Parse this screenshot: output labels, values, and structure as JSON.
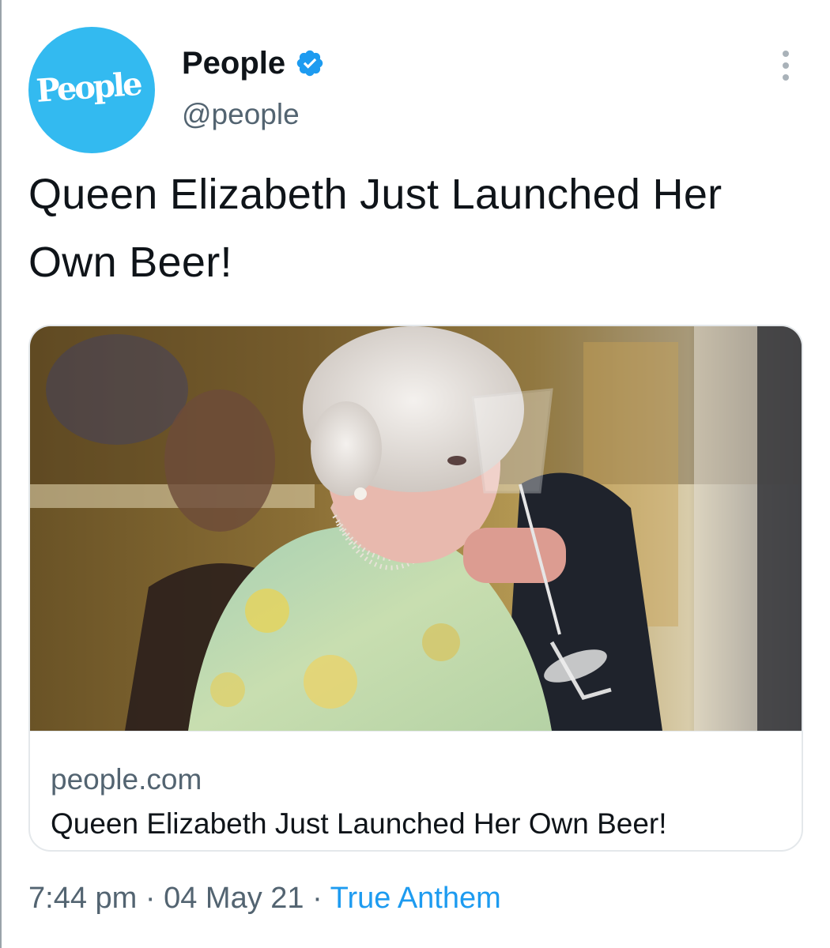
{
  "author": {
    "avatar_text": "People",
    "display_name": "People",
    "handle": "@people",
    "verified": true
  },
  "tweet": {
    "text": "Queen Elizabeth Just Launched Her Own Beer!"
  },
  "link_card": {
    "domain": "people.com",
    "title": "Queen Elizabeth Just Launched Her Own Beer!"
  },
  "meta": {
    "time": "7:44 pm",
    "separator": "·",
    "date": "04 May 21",
    "source": "True Anthem"
  },
  "colors": {
    "avatar_bg": "#33baf0",
    "verified": "#1d9bf0",
    "link": "#1d9bf0",
    "secondary_text": "#536471"
  }
}
